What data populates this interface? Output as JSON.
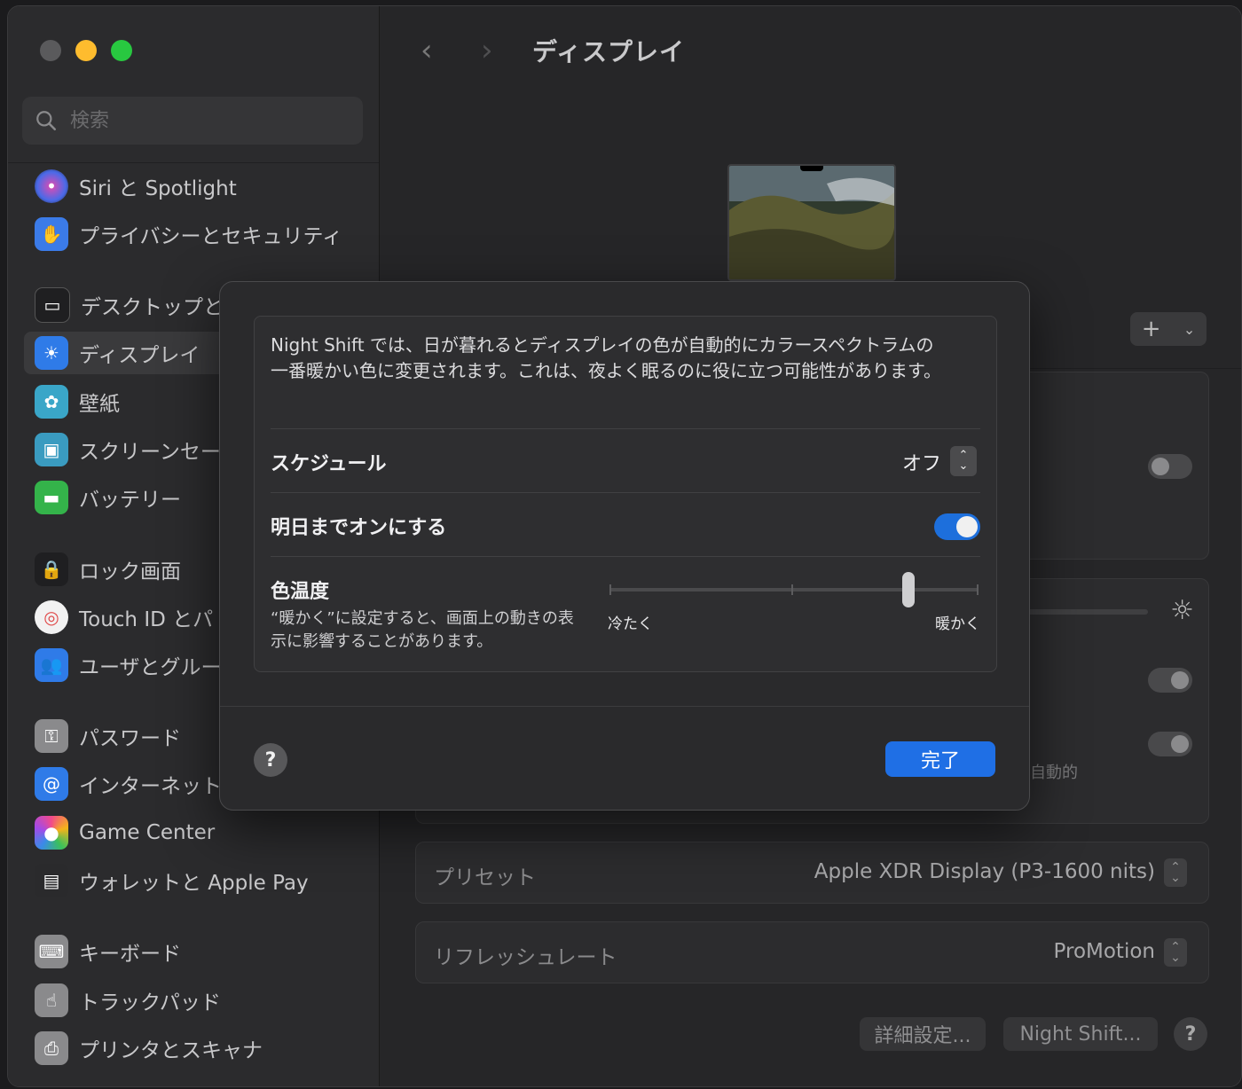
{
  "window": {
    "title": "ディスプレイ"
  },
  "search": {
    "placeholder": "検索"
  },
  "sidebar": {
    "items": [
      {
        "label": "Siri と Spotlight",
        "icon": "siri-icon",
        "color": "#6b4bd8"
      },
      {
        "label": "プライバシーとセキュリティ",
        "icon": "hand-icon",
        "color": "#3b7be8"
      },
      {
        "label": "デスクトップと",
        "icon": "dock-icon",
        "color": "#1f1f21"
      },
      {
        "label": "ディスプレイ",
        "icon": "sun-icon",
        "color": "#2f7be8"
      },
      {
        "label": "壁紙",
        "icon": "flower-icon",
        "color": "#3aa6c8"
      },
      {
        "label": "スクリーンセー",
        "icon": "screensaver-icon",
        "color": "#3a9bc0"
      },
      {
        "label": "バッテリー",
        "icon": "battery-icon",
        "color": "#34b34a"
      },
      {
        "label": "ロック画面",
        "icon": "lock-icon",
        "color": "#1f1f21"
      },
      {
        "label": "Touch ID とパ",
        "icon": "fingerprint-icon",
        "color": "#e04a4a"
      },
      {
        "label": "ユーザとグルー",
        "icon": "users-icon",
        "color": "#2f7be8"
      },
      {
        "label": "パスワード",
        "icon": "key-icon",
        "color": "#8a8a8c"
      },
      {
        "label": "インターネット",
        "icon": "at-icon",
        "color": "#2f7be8"
      },
      {
        "label": "Game Center",
        "icon": "game-center-icon",
        "color": "#e0e0e0"
      },
      {
        "label": "ウォレットと Apple Pay",
        "icon": "wallet-icon",
        "color": "#2a2a2c"
      },
      {
        "label": "キーボード",
        "icon": "keyboard-icon",
        "color": "#8a8a8c"
      },
      {
        "label": "トラックパッド",
        "icon": "trackpad-icon",
        "color": "#8a8a8c"
      },
      {
        "label": "プリンタとスキャナ",
        "icon": "printer-icon",
        "color": "#8a8a8c"
      }
    ]
  },
  "main": {
    "behind_label_auto": "自動的",
    "preset": {
      "label": "プリセット",
      "value": "Apple XDR Display (P3-1600 nits)"
    },
    "refresh": {
      "label": "リフレッシュレート",
      "value": "ProMotion"
    },
    "buttons": {
      "advanced": "詳細設定...",
      "night_shift": "Night Shift...",
      "help": "?"
    }
  },
  "modal": {
    "description": "Night Shift では、日が暮れるとディスプレイの色が自動的にカラースペクトラムの一番暖かい色に変更されます。これは、夜よく眠るのに役に立つ可能性があります。",
    "schedule": {
      "label": "スケジュール",
      "value": "オフ"
    },
    "until_tomorrow": {
      "label": "明日までオンにする",
      "on": true
    },
    "color_temp": {
      "label": "色温度",
      "note": "“暖かく”に設定すると、画面上の動きの表示に影響することがあります。",
      "min_label": "冷たく",
      "max_label": "暖かく",
      "level": 0.82
    },
    "help": "?",
    "done": "完了",
    "accent_color": "#1f6fe5"
  }
}
